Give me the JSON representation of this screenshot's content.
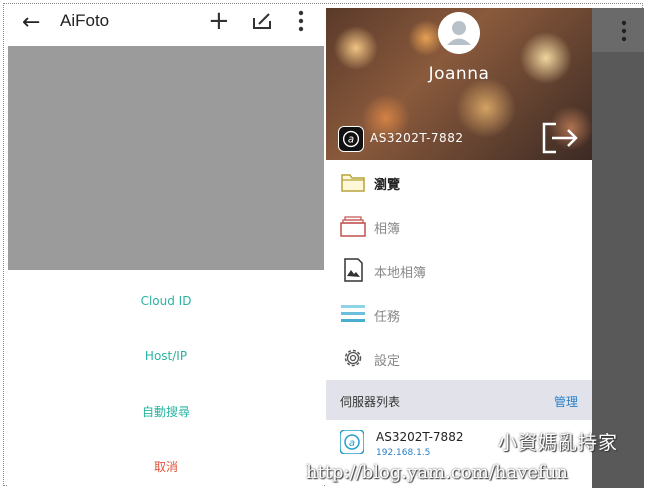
{
  "left_screen": {
    "app_title": "AiFoto",
    "icons": {
      "back": "arrow-left-icon",
      "add": "plus-icon",
      "edit": "edit-icon",
      "more": "more-vertical-icon"
    },
    "options": {
      "cloud_id": "Cloud ID",
      "host_ip": "Host/IP",
      "auto_search": "自動搜尋",
      "cancel": "取消"
    },
    "colors": {
      "option": "#2ab3a0",
      "cancel": "#e0533b",
      "placeholder": "#9b9b9b"
    }
  },
  "drawer": {
    "user_name": "Joanna",
    "nas_name": "AS3202T-7882",
    "menu": [
      {
        "label": "瀏覽",
        "icon": "folder-icon",
        "active": true
      },
      {
        "label": "相簿",
        "icon": "album-icon",
        "active": false
      },
      {
        "label": "本地相簿",
        "icon": "sd-card-icon",
        "active": false
      },
      {
        "label": "任務",
        "icon": "task-list-icon",
        "active": false
      },
      {
        "label": "設定",
        "icon": "gear-icon",
        "active": false
      }
    ],
    "server_list": {
      "title": "伺服器列表",
      "manage": "管理",
      "servers": [
        {
          "name": "AS3202T-7882",
          "ip": "192.168.1.5"
        }
      ]
    }
  },
  "watermark": {
    "title": "小資媽亂持家",
    "url": "http://blog.yam.com/havefun"
  }
}
